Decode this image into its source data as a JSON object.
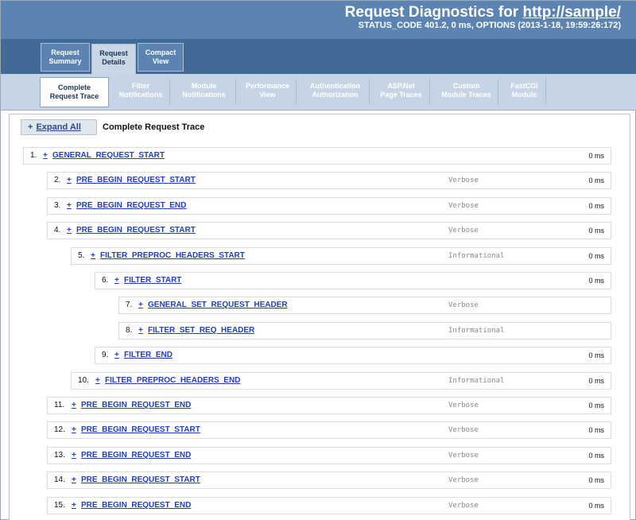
{
  "header": {
    "title_prefix": "Request Diagnostics for ",
    "title_link": "http://sample/",
    "subtitle": "STATUS_CODE 401.2, 0 ms, OPTIONS (2013-1-18, 19:59:26:172)"
  },
  "primary_tabs": [
    {
      "line1": "Request",
      "line2": "Summary",
      "active": false
    },
    {
      "line1": "Request",
      "line2": "Details",
      "active": true
    },
    {
      "line1": "Compact",
      "line2": "View",
      "active": false
    }
  ],
  "secondary_tabs": [
    {
      "line1": "Complete",
      "line2": "Request Trace",
      "active": true
    },
    {
      "line1": "Filter",
      "line2": "Notifications",
      "active": false
    },
    {
      "line1": "Module",
      "line2": "Notifications",
      "active": false
    },
    {
      "line1": "Performance",
      "line2": "View",
      "active": false
    },
    {
      "line1": "Authentication",
      "line2": "Authorization",
      "active": false
    },
    {
      "line1": "ASP.Net",
      "line2": "Page Traces",
      "active": false
    },
    {
      "line1": "Custom",
      "line2": "Module Traces",
      "active": false
    },
    {
      "line1": "FastCGI",
      "line2": "Module",
      "active": false
    }
  ],
  "toolbar": {
    "expand_plus": "+",
    "expand_label": "Expand All",
    "section_title": "Complete Request Trace"
  },
  "trace_rows": [
    {
      "num": "1.",
      "plus": "+",
      "name": "GENERAL_REQUEST_START",
      "level": "",
      "duration": "0 ms",
      "depth": 0
    },
    {
      "num": "2.",
      "plus": "+",
      "name": "PRE_BEGIN_REQUEST_START",
      "level": "Verbose",
      "duration": "0 ms",
      "depth": 1
    },
    {
      "num": "3.",
      "plus": "+",
      "name": "PRE_BEGIN_REQUEST_END",
      "level": "Verbose",
      "duration": "0 ms",
      "depth": 1
    },
    {
      "num": "4.",
      "plus": "+",
      "name": "PRE_BEGIN_REQUEST_START",
      "level": "Verbose",
      "duration": "0 ms",
      "depth": 1
    },
    {
      "num": "5.",
      "plus": "+",
      "name": "FILTER_PREPROC_HEADERS_START",
      "level": "Informational",
      "duration": "0 ms",
      "depth": 2
    },
    {
      "num": "6.",
      "plus": "+",
      "name": "FILTER_START",
      "level": "",
      "duration": "0 ms",
      "depth": 3
    },
    {
      "num": "7.",
      "plus": "+",
      "name": "GENERAL_SET_REQUEST_HEADER",
      "level": "Verbose",
      "duration": "",
      "depth": 4
    },
    {
      "num": "8.",
      "plus": "+",
      "name": "FILTER_SET_REQ_HEADER",
      "level": "Informational",
      "duration": "",
      "depth": 4
    },
    {
      "num": "9.",
      "plus": "+",
      "name": "FILTER_END",
      "level": "",
      "duration": "0 ms",
      "depth": 3
    },
    {
      "num": "10.",
      "plus": "+",
      "name": "FILTER_PREPROC_HEADERS_END",
      "level": "Informational",
      "duration": "0 ms",
      "depth": 2
    },
    {
      "num": "11.",
      "plus": "+",
      "name": "PRE_BEGIN_REQUEST_END",
      "level": "Verbose",
      "duration": "0 ms",
      "depth": 1
    },
    {
      "num": "12.",
      "plus": "+",
      "name": "PRE_BEGIN_REQUEST_START",
      "level": "Verbose",
      "duration": "0 ms",
      "depth": 1
    },
    {
      "num": "13.",
      "plus": "+",
      "name": "PRE_BEGIN_REQUEST_END",
      "level": "Verbose",
      "duration": "0 ms",
      "depth": 1
    },
    {
      "num": "14.",
      "plus": "+",
      "name": "PRE_BEGIN_REQUEST_START",
      "level": "Verbose",
      "duration": "0 ms",
      "depth": 1
    },
    {
      "num": "15.",
      "plus": "+",
      "name": "PRE_BEGIN_REQUEST_END",
      "level": "Verbose",
      "duration": "0 ms",
      "depth": 1
    }
  ]
}
